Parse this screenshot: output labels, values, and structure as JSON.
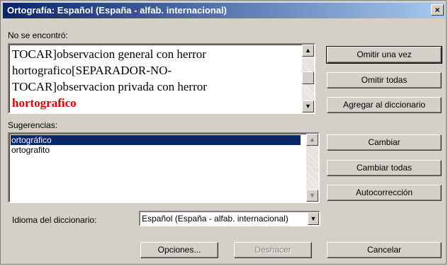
{
  "dialog": {
    "title": "Ortografía: Español (España - alfab. internacional)",
    "close_label": "×"
  },
  "not_found": {
    "label": "No se encontró:",
    "lines": [
      "TOCAR]observacion general con herror",
      "hortografico[SEPARADOR-NO-",
      "TOCAR]observacion privada con herror"
    ],
    "error_word": "hortografico"
  },
  "suggestions": {
    "label": "Sugerencias:",
    "items": [
      "ortográfico",
      "ortografito"
    ],
    "selected_index": 0
  },
  "language": {
    "label": "Idioma del diccionario:",
    "value": "Español (España - alfab. internacional)"
  },
  "buttons": {
    "ignore_once": "Omitir una vez",
    "ignore_all": "Omitir todas",
    "add_to_dictionary": "Agregar al diccionario",
    "change": "Cambiar",
    "change_all": "Cambiar todas",
    "autocorrect": "Autocorrección",
    "options": "Opciones...",
    "undo": "Deshacer",
    "cancel": "Cancelar"
  },
  "icons": {
    "up": "▲",
    "down": "▼"
  }
}
